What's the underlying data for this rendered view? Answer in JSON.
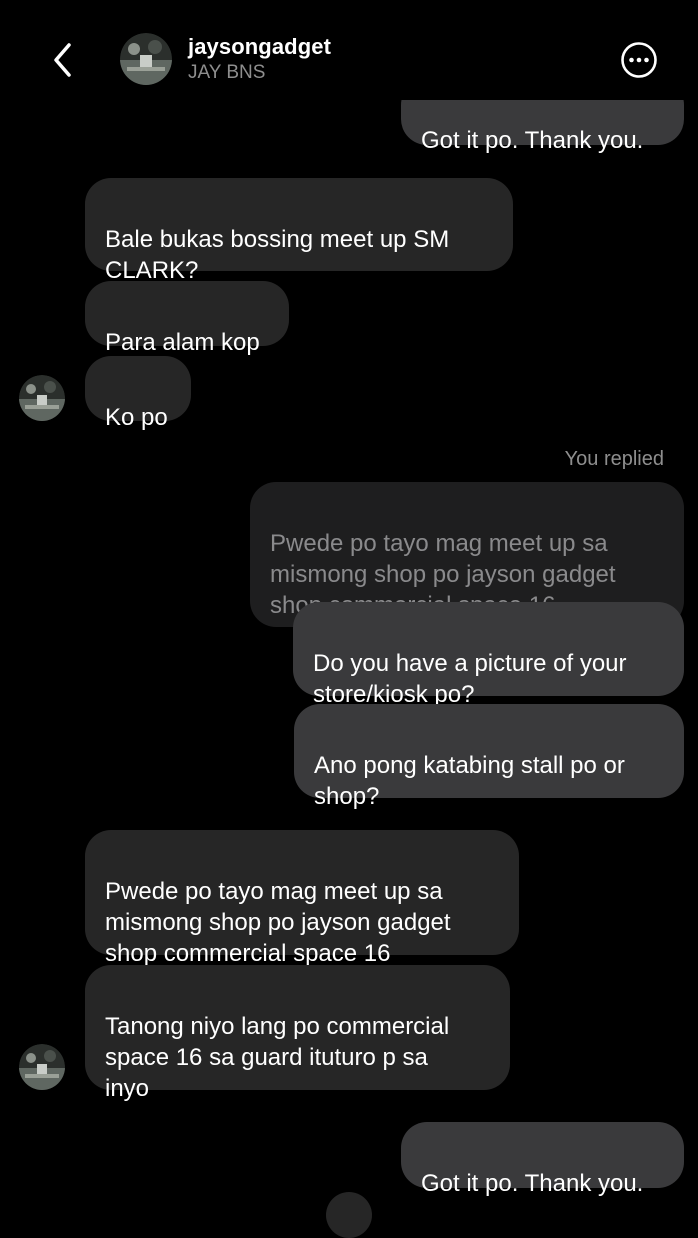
{
  "header": {
    "username": "jaysongadget",
    "display_name": "JAY BNS"
  },
  "messages": {
    "m0": "Got it po. Thank you.",
    "m1": "Bale bukas bossing  meet up SM\nCLARK?",
    "m2": "Para alam kop",
    "m3": "Ko po",
    "reply_label": "You replied",
    "quoted": "Pwede po tayo mag meet up sa\nmismong  shop po jayson gadget\nshop  commercial space 16",
    "m4": "Do you have a picture of your\nstore/kiosk po?",
    "m5": "Ano pong katabing stall po or\nshop?",
    "m6": "Pwede po tayo mag meet up sa\nmismong  shop po jayson gadget\nshop  commercial space 16",
    "m7": "Tanong niyo lang po commercial\nspace 16   sa guard ituturo p sa\ninyo",
    "m8": "Got it po. Thank you."
  },
  "icons": {
    "back": "chevron-left-icon",
    "more": "more-horizontal-circle-icon"
  }
}
